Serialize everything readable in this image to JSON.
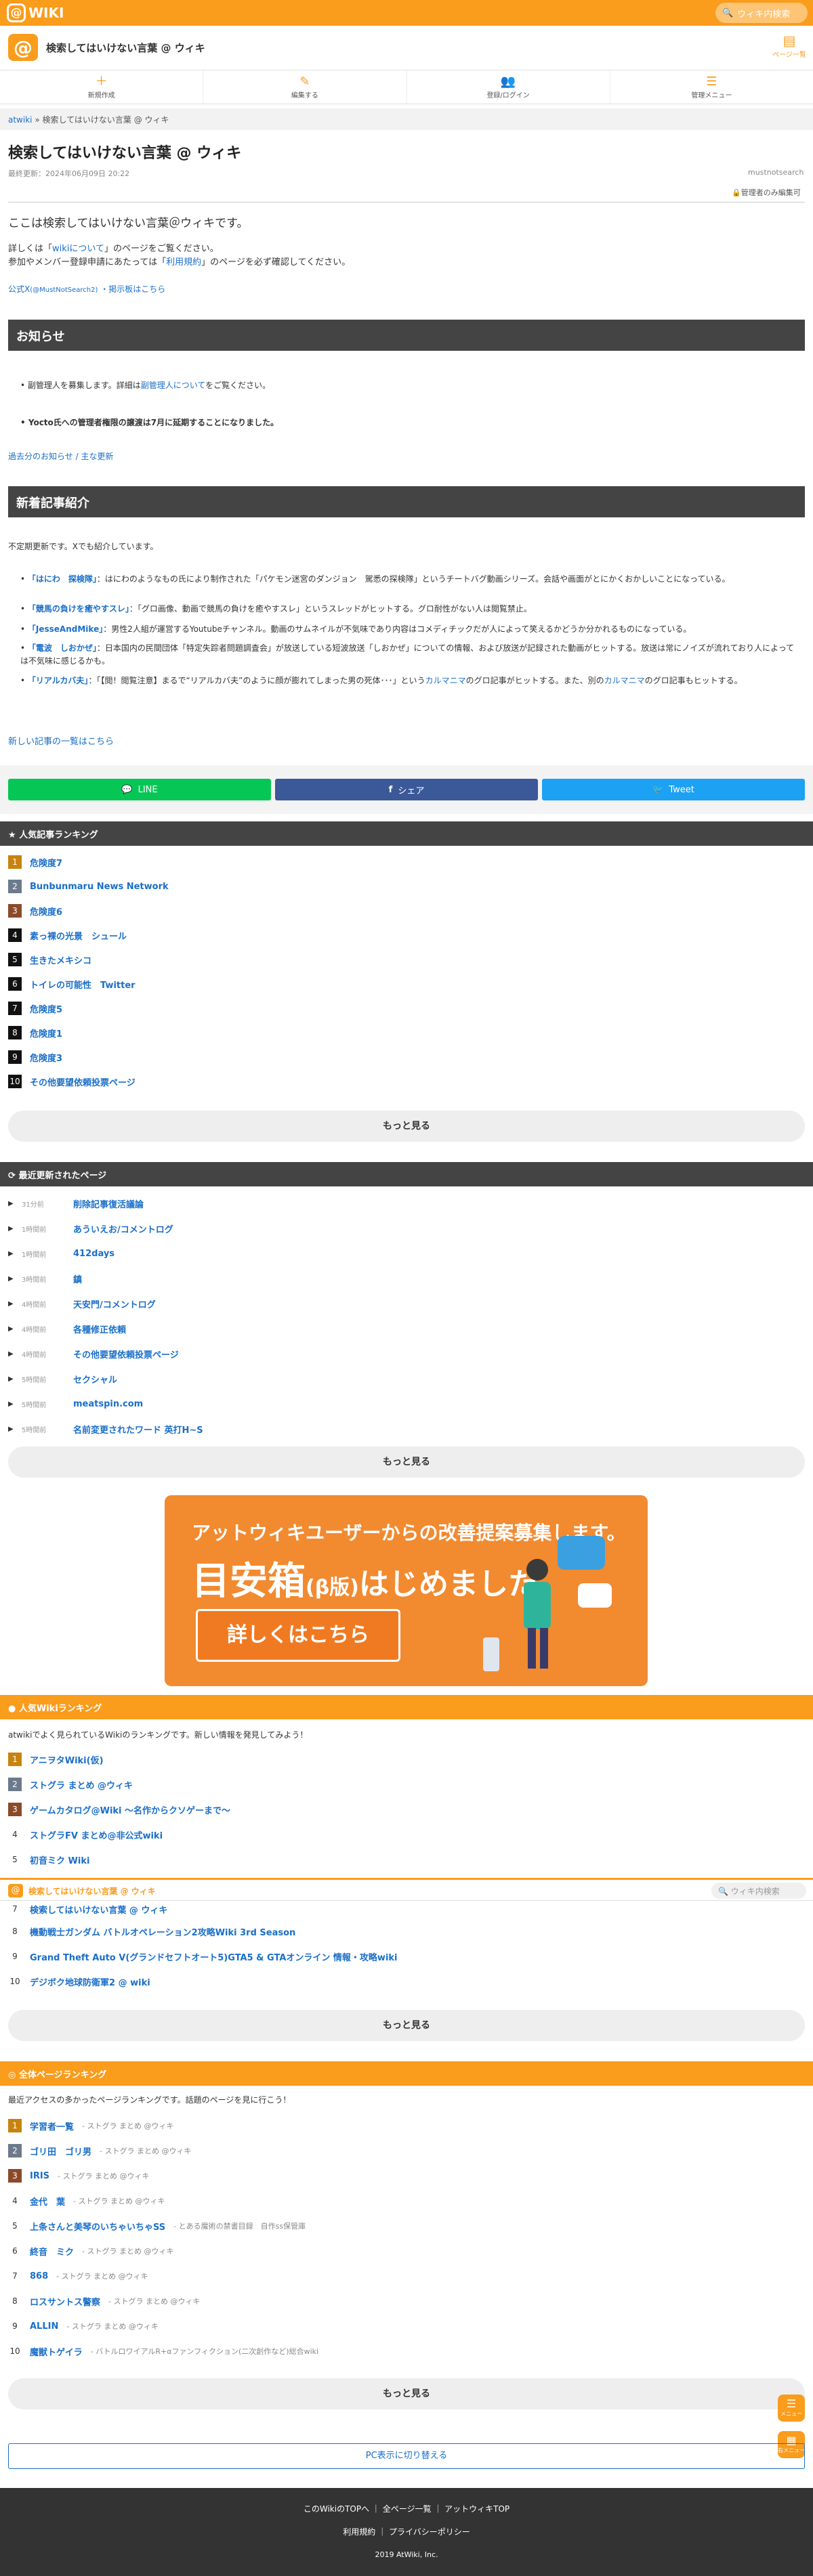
{
  "header": {
    "brand": "WIKI",
    "search_placeholder": "ウィキ内検索",
    "wiki_title": "検索してはいけない言葉 @ ウィキ",
    "page_menu": "ページ一覧"
  },
  "toolbar": [
    {
      "icon": "plus-icon",
      "label": "新規作成"
    },
    {
      "icon": "pencil-icon",
      "label": "編集する"
    },
    {
      "icon": "users-icon",
      "label": "登録/ログイン"
    },
    {
      "icon": "menu-icon",
      "label": "管理メニュー"
    }
  ],
  "breadcrumb": {
    "root": "atwiki",
    "sep": "»",
    "current": "検索してはいけない言葉 @ ウィキ"
  },
  "page": {
    "title": "検索してはいけない言葉 @ ウィキ",
    "updated": "最終更新：2024年06月09日 20:22",
    "author": "mustnotsearch",
    "edit_request": "管理者のみ編集可",
    "intro": "ここは検索してはいけない言葉＠ウィキです。",
    "p2a_pre": "詳しくは「",
    "p2a_link": "wikiについて",
    "p2a_post": "」のページをご覧ください。",
    "p2b_pre": "参加やメンバー登録申請にあたっては「",
    "p2b_link": "利用規約",
    "p2b_post": "」のページを必ず確認してください。",
    "official": "公式X",
    "official_handle": "(@MustNotSearch2)",
    "board": "・掲示板はこちら"
  },
  "news": {
    "heading": "お知らせ",
    "item1_pre": "副管理人を募集します。詳細は",
    "item1_link": "副管理人について",
    "item1_post": "をご覧ください。",
    "item2": "Yocto氏への管理者権限の譲渡は7月に延期することになりました。",
    "past": "過去分のお知らせ / 主な更新"
  },
  "newarticles": {
    "heading": "新着記事紹介",
    "desc": "不定期更新です。Xでも紹介しています。",
    "items": [
      {
        "link": "「はにわ　探検隊」",
        "text": "：はにわのようなもの氏により制作された「パケモン迷宮のダンジョン　駕悉の探検隊」というチートバグ動画シリーズ。会話や画面がとにかくおかしいことになっている。"
      },
      {
        "link": "「競馬の負けを癒やすスレ」",
        "text": "：「グロ画像、動画で競馬の負けを癒やすスレ」というスレッドがヒットする。グロ耐性がない人は閲覧禁止。"
      },
      {
        "link": "「JesseAndMike」",
        "text": "：男性2人組が運営するYoutubeチャンネル。動画のサムネイルが不気味であり内容はコメディチックだが人によって笑えるかどうか分かれるものになっている。"
      },
      {
        "link": "「電波　しおかぜ」",
        "text": "：日本国内の民間団体「特定失踪者問題調査会」が放送している短波放送「しおかぜ」についての情報、および放送が記録された動画がヒットする。放送は常にノイズが流れており人によっては不気味に感じるかも。"
      },
      {
        "link": "「リアルカバ夫」",
        "text": "：「【閲！閲覧注意】まるで“リアルカバ夫”のように顔が膨れてしまった男の死体･･･」という",
        "link2": "カルマニマ",
        "text2": "のグロ記事がヒットする。また、別の",
        "link3": "カルマニマ",
        "text3": "のグロ記事もヒットする。"
      }
    ],
    "list_link": "新しい記事の一覧はこちら"
  },
  "share": {
    "line": "LINE",
    "facebook": "シェア",
    "twitter": "Tweet"
  },
  "popular": {
    "heading": "人気記事ランキング",
    "items": [
      "危険度7",
      "Bunbunmaru News Network",
      "危険度6",
      "素っ裸の光景　シュール",
      "生きたメキシコ",
      "トイレの可能性　Twitter",
      "危険度5",
      "危険度1",
      "危険度3",
      "その他要望依頼投票ページ"
    ],
    "more": "もっと見る"
  },
  "recent": {
    "heading": "最近更新されたページ",
    "items": [
      {
        "time": "31分前",
        "name": "削除記事復活議論"
      },
      {
        "time": "1時間前",
        "name": "あういえお/コメントログ"
      },
      {
        "time": "1時間前",
        "name": "412days"
      },
      {
        "time": "3時間前",
        "name": "鎮"
      },
      {
        "time": "4時間前",
        "name": "天安門/コメントログ"
      },
      {
        "time": "4時間前",
        "name": "各種修正依頼"
      },
      {
        "time": "4時間前",
        "name": "その他要望依頼投票ページ"
      },
      {
        "time": "5時間前",
        "name": "セクシャル"
      },
      {
        "time": "5時間前",
        "name": "meatspin.com"
      },
      {
        "time": "5時間前",
        "name": "名前変更されたワード 英打H~S"
      }
    ],
    "more": "もっと見る"
  },
  "banner": {
    "line1": "アットウィキユーザーからの改善提案募集します。",
    "line2a": "目安箱",
    "line2b": "(β版)",
    "line2c": "はじめました。",
    "button": "詳しくはこちら"
  },
  "wikirank": {
    "heading": "人気Wikiランキング",
    "desc": "atwikiでよく見られているWikiのランキングです。新しい情報を発見してみよう！",
    "items": [
      "アニヲタWiki(仮)",
      "ストグラ まとめ @ウィキ",
      "ゲームカタログ@Wiki ～名作からクソゲーまで～",
      "ストグラFV まとめ@非公式wiki",
      "初音ミク Wiki"
    ],
    "items2": [
      {
        "n": "7",
        "name": "検索してはいけない言葉 @ ウィキ"
      },
      {
        "n": "8",
        "name": "機動戦士ガンダム バトルオペレーション2攻略Wiki 3rd Season"
      },
      {
        "n": "9",
        "name": "Grand Theft Auto V(グランドセフトオート5)GTA5 & GTAオンライン 情報・攻略wiki"
      },
      {
        "n": "10",
        "name": "デジボク地球防衛軍2 @ wiki"
      }
    ],
    "more": "もっと見る"
  },
  "sticky": {
    "title": "検索してはいけない言葉 @ ウィキ",
    "search_placeholder": "ウィキ内検索"
  },
  "allrank": {
    "heading": "全体ページランキング",
    "desc": "最近アクセスの多かったページランキングです。話題のページを見に行こう！",
    "items": [
      {
        "name": "学習者一覧",
        "src": "- ストグラ まとめ @ウィキ"
      },
      {
        "name": "ゴリ田　ゴリ男",
        "src": "- ストグラ まとめ @ウィキ"
      },
      {
        "name": "IRIS",
        "src": "- ストグラ まとめ @ウィキ"
      },
      {
        "name": "金代　葉",
        "src": "- ストグラ まとめ @ウィキ"
      },
      {
        "name": "上条さんと美琴のいちゃいちゃSS",
        "src": "- とある魔術の禁書目録　自作ss保管庫"
      },
      {
        "name": "終音　ミク",
        "src": "- ストグラ まとめ @ウィキ"
      },
      {
        "name": "868",
        "src": "- ストグラ まとめ @ウィキ"
      },
      {
        "name": "ロスサントス警察",
        "src": "- ストグラ まとめ @ウィキ"
      },
      {
        "name": "ALLIN",
        "src": "- ストグラ まとめ @ウィキ"
      },
      {
        "name": "魔獣トゲイラ",
        "src": "- バトルロワイアルR+αファンフィクション(二次創作など)総合wiki"
      }
    ],
    "more": "もっと見る"
  },
  "float": {
    "menu": "メニュー",
    "wiki": "右メニュー"
  },
  "pcswitch": "PC表示に切り替える",
  "footer": {
    "links": [
      "このWikiのTOPへ",
      "全ページ一覧",
      "アットウィキTOP"
    ],
    "links2": [
      "利用規約",
      "プライバシーポリシー"
    ],
    "copy": "2019 AtWiki, Inc."
  },
  "colors": {
    "accent": "#fa9c1c",
    "link": "#1a6fc9",
    "dark": "#444444"
  }
}
